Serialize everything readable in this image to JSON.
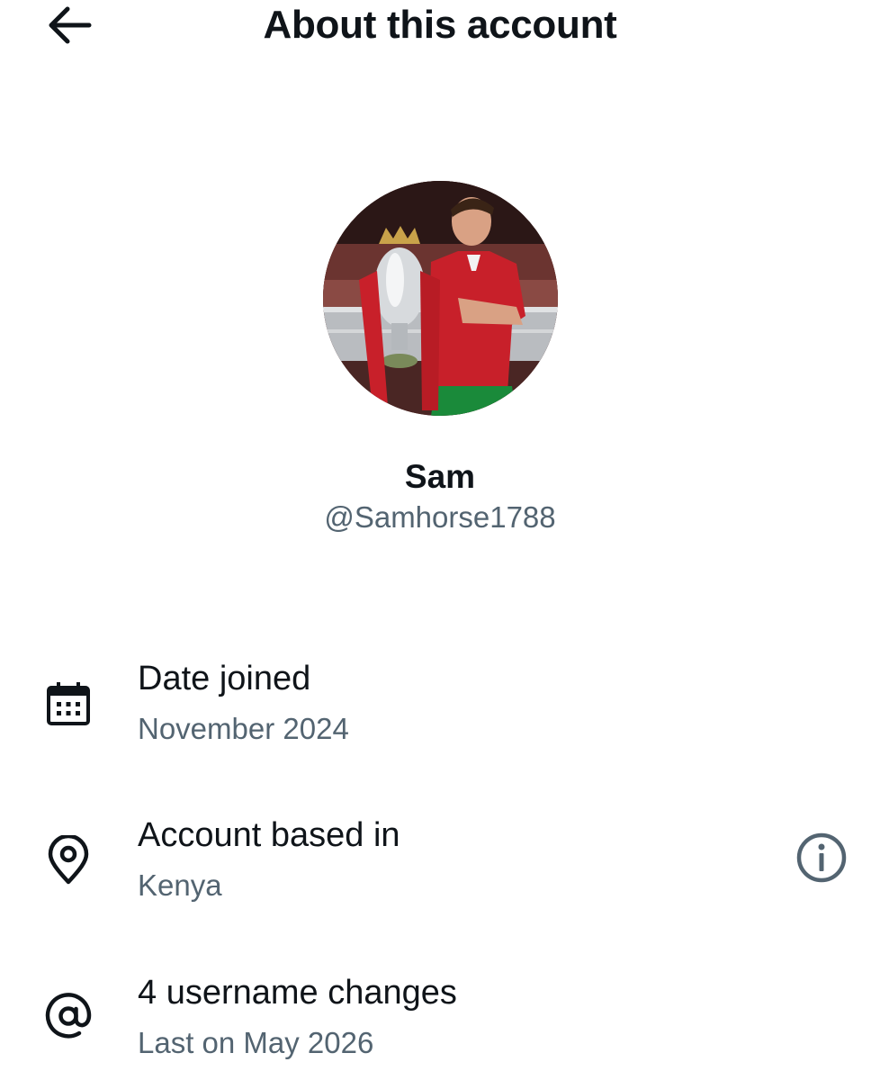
{
  "header": {
    "title": "About this account",
    "back_icon": "arrow-left-icon"
  },
  "profile": {
    "display_name": "Sam",
    "handle": "@Samhorse1788",
    "avatar_description_icon": "avatar-photo"
  },
  "rows": [
    {
      "icon": "calendar-icon",
      "title": "Date joined",
      "subtitle": "November 2024"
    },
    {
      "icon": "location-pin-icon",
      "title": "Account based in",
      "subtitle": "Kenya",
      "trailing_icon": "info-icon"
    },
    {
      "icon": "at-sign-icon",
      "title": "4 username changes",
      "subtitle": "Last on May 2026"
    }
  ],
  "colors": {
    "primary_text": "#0f1419",
    "secondary_text": "#536471",
    "background": "#ffffff"
  }
}
